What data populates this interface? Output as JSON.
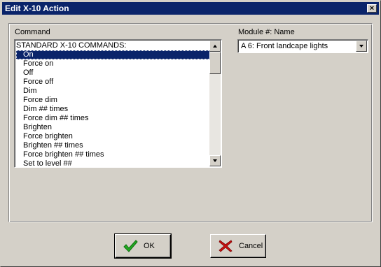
{
  "window": {
    "title": "Edit X-10 Action",
    "close_glyph": "×"
  },
  "command": {
    "label": "Command",
    "items": [
      "STANDARD X-10 COMMANDS:",
      "On",
      "Force on",
      "Off",
      "Force off",
      "Dim",
      "Force dim",
      "Dim ## times",
      "Force dim ## times",
      "Brighten",
      "Force brighten",
      "Brighten ## times",
      "Force brighten ## times",
      "Set to level ##"
    ],
    "selected_index": 1
  },
  "module": {
    "label": "Module #: Name",
    "value": "A 6: Front landcape lights"
  },
  "buttons": {
    "ok_label": "OK",
    "cancel_label": "Cancel"
  },
  "colors": {
    "titlebar": "#0a246a",
    "face": "#d4d0c8",
    "ok_check": "#22aa22",
    "cancel_x": "#cc1111"
  },
  "icons": {
    "ok": "green-checkmark-icon",
    "cancel": "red-x-icon",
    "close": "close-icon"
  }
}
